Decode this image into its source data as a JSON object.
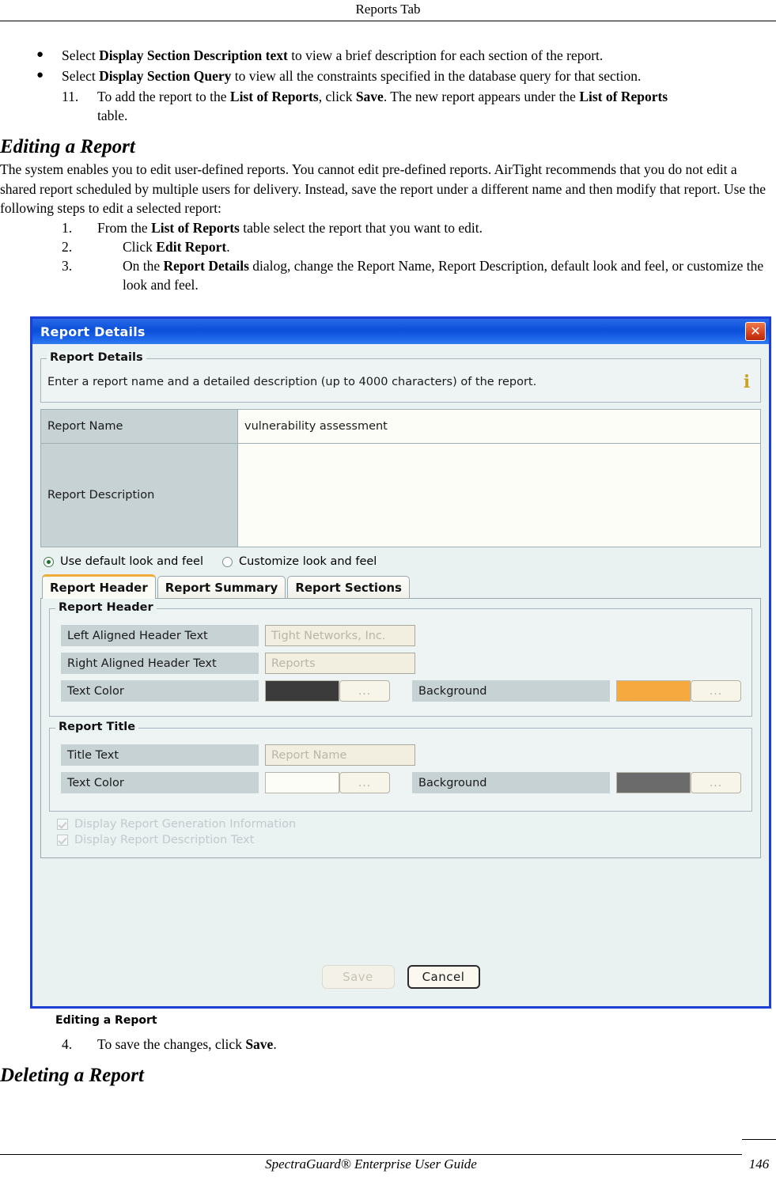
{
  "page": {
    "running_head": "Reports Tab",
    "footer_title": "SpectraGuard®  Enterprise User Guide",
    "page_number": "146"
  },
  "bullets": [
    {
      "pre": "Select ",
      "bold": "Display Section Description text",
      "post": " to view a brief description for each section of the report."
    },
    {
      "pre": "Select ",
      "bold": "Display Section Query",
      "post": " to view all the constraints specified in the database query for that section."
    }
  ],
  "step11": {
    "num": "11.",
    "t1": "To add the report to the ",
    "b1": "List of Reports",
    "t2": ", click ",
    "b2": "Save",
    "t3": ". The new report appears under the ",
    "b3": "List of Reports",
    "cont": "table."
  },
  "editing_section": {
    "heading": "Editing a Report",
    "paragraph": "The system enables you to edit user-defined reports. You cannot edit pre-defined reports. AirTight recommends that you do not edit a shared report scheduled by multiple users for delivery. Instead, save the report under a different name and then modify that report. Use the following steps to edit a selected report:",
    "steps": [
      {
        "num": "1.",
        "t1": "From the ",
        "b1": "List of Reports",
        "t2": " table select the report that you want to edit."
      },
      {
        "num": "2.",
        "t1": "Click ",
        "b1": "Edit Report",
        "t2": "."
      },
      {
        "num": "3.",
        "t1": "On the ",
        "b1": "Report Details",
        "t2": " dialog, change the Report Name, Report Description, default look and feel, or customize the look and feel."
      }
    ]
  },
  "figure_caption": "Editing a Report",
  "step4": {
    "num": "4.",
    "t1": "To save the changes, click ",
    "b1": "Save",
    "t2": "."
  },
  "deleting_section": {
    "heading": "Deleting a Report"
  },
  "dialog": {
    "title": "Report Details",
    "close_label": "✕",
    "group_report_details": {
      "title": "Report Details",
      "description": "Enter a report name and a detailed description (up to 4000 characters) of the report.",
      "info_icon": "i"
    },
    "fields": {
      "report_name_label": "Report Name",
      "report_name_value": "vulnerability assessment",
      "report_description_label": "Report Description",
      "report_description_value": ""
    },
    "look_and_feel": {
      "default_label": "Use default look and feel",
      "custom_label": "Customize look and feel",
      "selected": "default"
    },
    "tabs": [
      {
        "label": "Report Header",
        "active": true
      },
      {
        "label": "Report Summary",
        "active": false
      },
      {
        "label": "Report Sections",
        "active": false
      }
    ],
    "report_header_group": {
      "title": "Report Header",
      "left_aligned_label": "Left Aligned Header Text",
      "left_aligned_value": "Tight Networks, Inc.",
      "right_aligned_label": "Right Aligned Header Text",
      "right_aligned_value": "Reports",
      "text_color_label": "Text Color",
      "text_color_value": "#3b3b3b",
      "background_label": "Background",
      "background_value": "#f5a93f",
      "ellipsis_label": "..."
    },
    "report_title_group": {
      "title": "Report Title",
      "title_text_label": "Title Text",
      "title_text_value": "Report Name",
      "text_color_label": "Text Color",
      "text_color_value": "#fdfdf8",
      "background_label": "Background",
      "background_value": "#6b6b6b",
      "ellipsis_label": "..."
    },
    "checkboxes": [
      {
        "label": "Display Report Generation Information",
        "checked": true
      },
      {
        "label": "Display Report Description Text",
        "checked": true
      }
    ],
    "buttons": {
      "save": "Save",
      "cancel": "Cancel"
    }
  }
}
